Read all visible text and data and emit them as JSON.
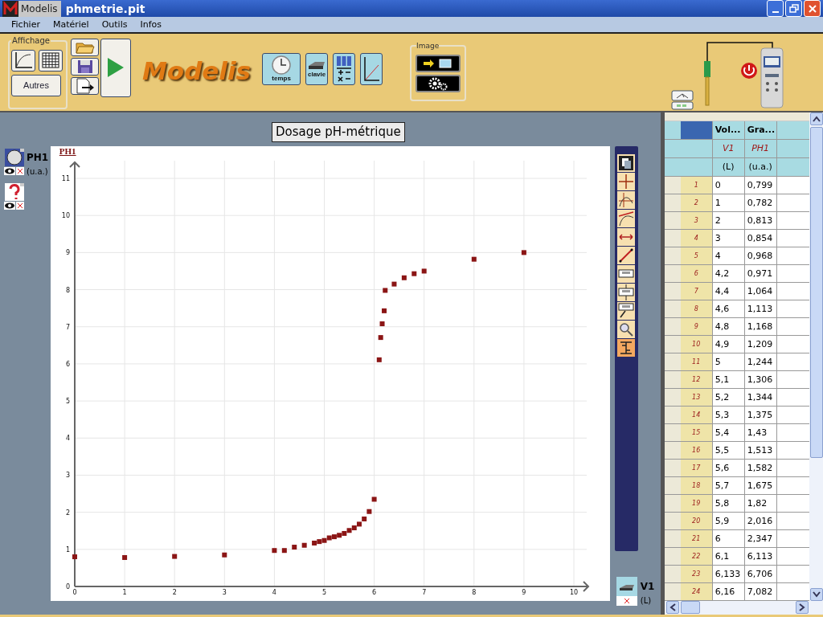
{
  "window": {
    "app_badge": "Modelis",
    "title": "phmetrie.pit"
  },
  "menu": [
    "Fichier",
    "Matériel",
    "Outils",
    "Infos"
  ],
  "toolbar": {
    "display_group": "Affichage",
    "other_button": "Autres",
    "logo": "Modelis",
    "time_button": "temps",
    "keyboard_button": "clavie",
    "image_group": "Image"
  },
  "variables": [
    {
      "kind": "sensor",
      "name": "PH1",
      "unit": "(u.a.)"
    },
    {
      "kind": "unknown"
    }
  ],
  "graph": {
    "title": "Dosage pH-métrique",
    "chart_data": {
      "type": "scatter",
      "ylabel": "PH1",
      "grid": true,
      "xlim": [
        0,
        10
      ],
      "ylim": [
        0,
        11
      ],
      "xticks": [
        0,
        1,
        2,
        3,
        4,
        5,
        6,
        7,
        8,
        9,
        10
      ],
      "yticks": [
        0,
        1,
        2,
        3,
        4,
        5,
        6,
        7,
        8,
        9,
        10,
        11
      ],
      "x": [
        0,
        1,
        2,
        3,
        4,
        4.2,
        4.4,
        4.6,
        4.8,
        4.9,
        5,
        5.1,
        5.2,
        5.3,
        5.4,
        5.5,
        5.6,
        5.7,
        5.8,
        5.9,
        6,
        6.1,
        6.13,
        6.16,
        6.2,
        6.22,
        6.4,
        6.6,
        6.8,
        7,
        8,
        9
      ],
      "series": [
        {
          "color": "#8b1515",
          "values": [
            0.8,
            0.78,
            0.81,
            0.85,
            0.97,
            0.97,
            1.06,
            1.11,
            1.17,
            1.21,
            1.24,
            1.31,
            1.34,
            1.38,
            1.43,
            1.51,
            1.58,
            1.68,
            1.82,
            2.02,
            2.35,
            6.11,
            6.71,
            7.08,
            7.43,
            7.98,
            8.15,
            8.32,
            8.43,
            8.5,
            8.82,
            9.0
          ]
        }
      ]
    }
  },
  "graph_tools": [
    {
      "kind": "copy",
      "selected": false
    },
    {
      "kind": "grid",
      "selected": false
    },
    {
      "kind": "curve-grid",
      "selected": false
    },
    {
      "kind": "tangent",
      "selected": false
    },
    {
      "kind": "measure",
      "selected": false
    },
    {
      "kind": "line",
      "selected": false
    },
    {
      "kind": "label",
      "selected": false
    },
    {
      "kind": "label-cross",
      "selected": false
    },
    {
      "kind": "label-pointer",
      "selected": false
    },
    {
      "kind": "zoom",
      "selected": false
    },
    {
      "kind": "scale",
      "selected": true
    }
  ],
  "x_variable": {
    "name": "V1",
    "unit": "(L)"
  },
  "table": {
    "columns": [
      {
        "header": "Vol...",
        "symbol": "V1",
        "unit": "(L)"
      },
      {
        "header": "Gra...",
        "symbol": "PH1",
        "unit": "(u.a.)"
      }
    ],
    "rows": [
      {
        "index": "1",
        "cells": [
          "0",
          "0,799"
        ]
      },
      {
        "index": "2",
        "cells": [
          "1",
          "0,782"
        ]
      },
      {
        "index": "3",
        "cells": [
          "2",
          "0,813"
        ]
      },
      {
        "index": "4",
        "cells": [
          "3",
          "0,854"
        ]
      },
      {
        "index": "5",
        "cells": [
          "4",
          "0,968"
        ]
      },
      {
        "index": "6",
        "cells": [
          "4,2",
          "0,971"
        ]
      },
      {
        "index": "7",
        "cells": [
          "4,4",
          "1,064"
        ]
      },
      {
        "index": "8",
        "cells": [
          "4,6",
          "1,113"
        ]
      },
      {
        "index": "9",
        "cells": [
          "4,8",
          "1,168"
        ]
      },
      {
        "index": "10",
        "cells": [
          "4,9",
          "1,209"
        ]
      },
      {
        "index": "11",
        "cells": [
          "5",
          "1,244"
        ]
      },
      {
        "index": "12",
        "cells": [
          "5,1",
          "1,306"
        ]
      },
      {
        "index": "13",
        "cells": [
          "5,2",
          "1,344"
        ]
      },
      {
        "index": "14",
        "cells": [
          "5,3",
          "1,375"
        ]
      },
      {
        "index": "15",
        "cells": [
          "5,4",
          "1,43"
        ]
      },
      {
        "index": "16",
        "cells": [
          "5,5",
          "1,513"
        ]
      },
      {
        "index": "17",
        "cells": [
          "5,6",
          "1,582"
        ]
      },
      {
        "index": "18",
        "cells": [
          "5,7",
          "1,675"
        ]
      },
      {
        "index": "19",
        "cells": [
          "5,8",
          "1,82"
        ]
      },
      {
        "index": "20",
        "cells": [
          "5,9",
          "2,016"
        ]
      },
      {
        "index": "21",
        "cells": [
          "6",
          "2,347"
        ]
      },
      {
        "index": "22",
        "cells": [
          "6,1",
          "6,113"
        ]
      },
      {
        "index": "23",
        "cells": [
          "6,133",
          "6,706"
        ]
      },
      {
        "index": "24",
        "cells": [
          "6,16",
          "7,082"
        ]
      }
    ]
  }
}
